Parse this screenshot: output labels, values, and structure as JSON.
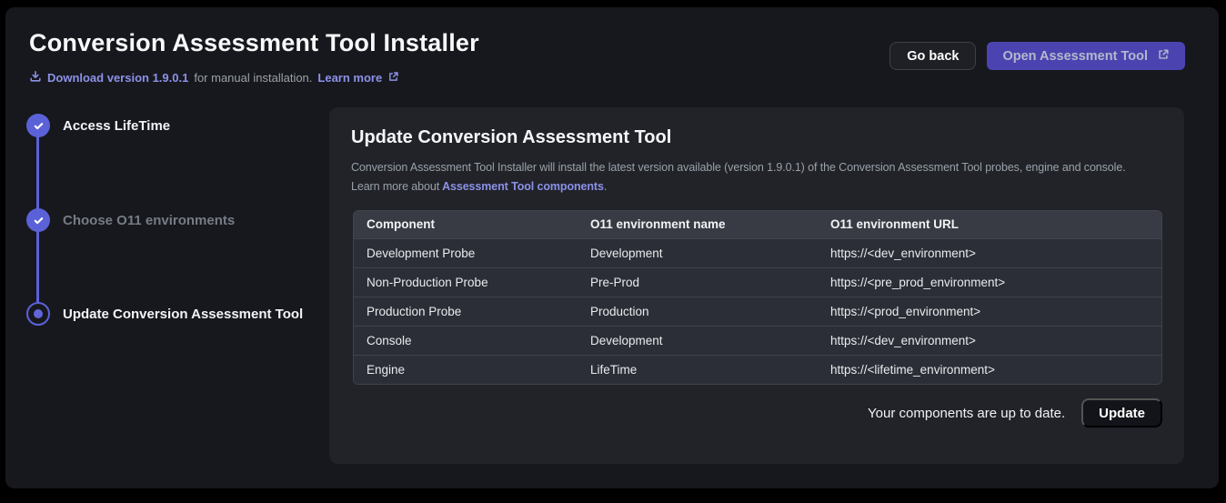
{
  "header": {
    "title": "Conversion Assessment Tool Installer",
    "download_link": "Download version 1.9.0.1",
    "download_rest": "for manual installation.",
    "learn_more_label": "Learn more",
    "go_back_label": "Go back",
    "open_tool_label": "Open Assessment Tool"
  },
  "stepper": {
    "steps": [
      {
        "label": "Access LifeTime",
        "state": "completed"
      },
      {
        "label": "Choose O11 environments",
        "state": "completed"
      },
      {
        "label": "Update Conversion Assessment Tool",
        "state": "current"
      }
    ]
  },
  "panel": {
    "title": "Update Conversion Assessment Tool",
    "description_line1": "Conversion Assessment Tool Installer will install the latest version available (version 1.9.0.1) of the Conversion Assessment Tool probes, engine and console.",
    "description_line2_prefix": "Learn more about",
    "description_line2_link": "Assessment Tool components",
    "description_line2_suffix": ".",
    "table": {
      "columns": [
        "Component",
        "O11 environment name",
        "O11 environment URL"
      ],
      "rows": [
        {
          "component": "Development Probe",
          "env_name": "Development",
          "env_url": "https://<dev_environment>"
        },
        {
          "component": "Non-Production Probe",
          "env_name": "Pre-Prod",
          "env_url": "https://<pre_prod_environment>"
        },
        {
          "component": "Production Probe",
          "env_name": "Production",
          "env_url": "https://<prod_environment>"
        },
        {
          "component": "Console",
          "env_name": "Development",
          "env_url": "https://<dev_environment>"
        },
        {
          "component": "Engine",
          "env_name": "LifeTime",
          "env_url": "https://<lifetime_environment>"
        }
      ]
    },
    "footer": {
      "status_text": "Your components are up to date.",
      "update_label": "Update"
    }
  },
  "colors": {
    "accent_purple": "#5b62d8",
    "link_purple": "#8c91e8",
    "open_button_bg": "#4b44b0",
    "window_bg": "#17181d",
    "panel_bg": "#212329",
    "table_header_bg": "#383b44",
    "table_row_bg": "#2b2e36"
  }
}
